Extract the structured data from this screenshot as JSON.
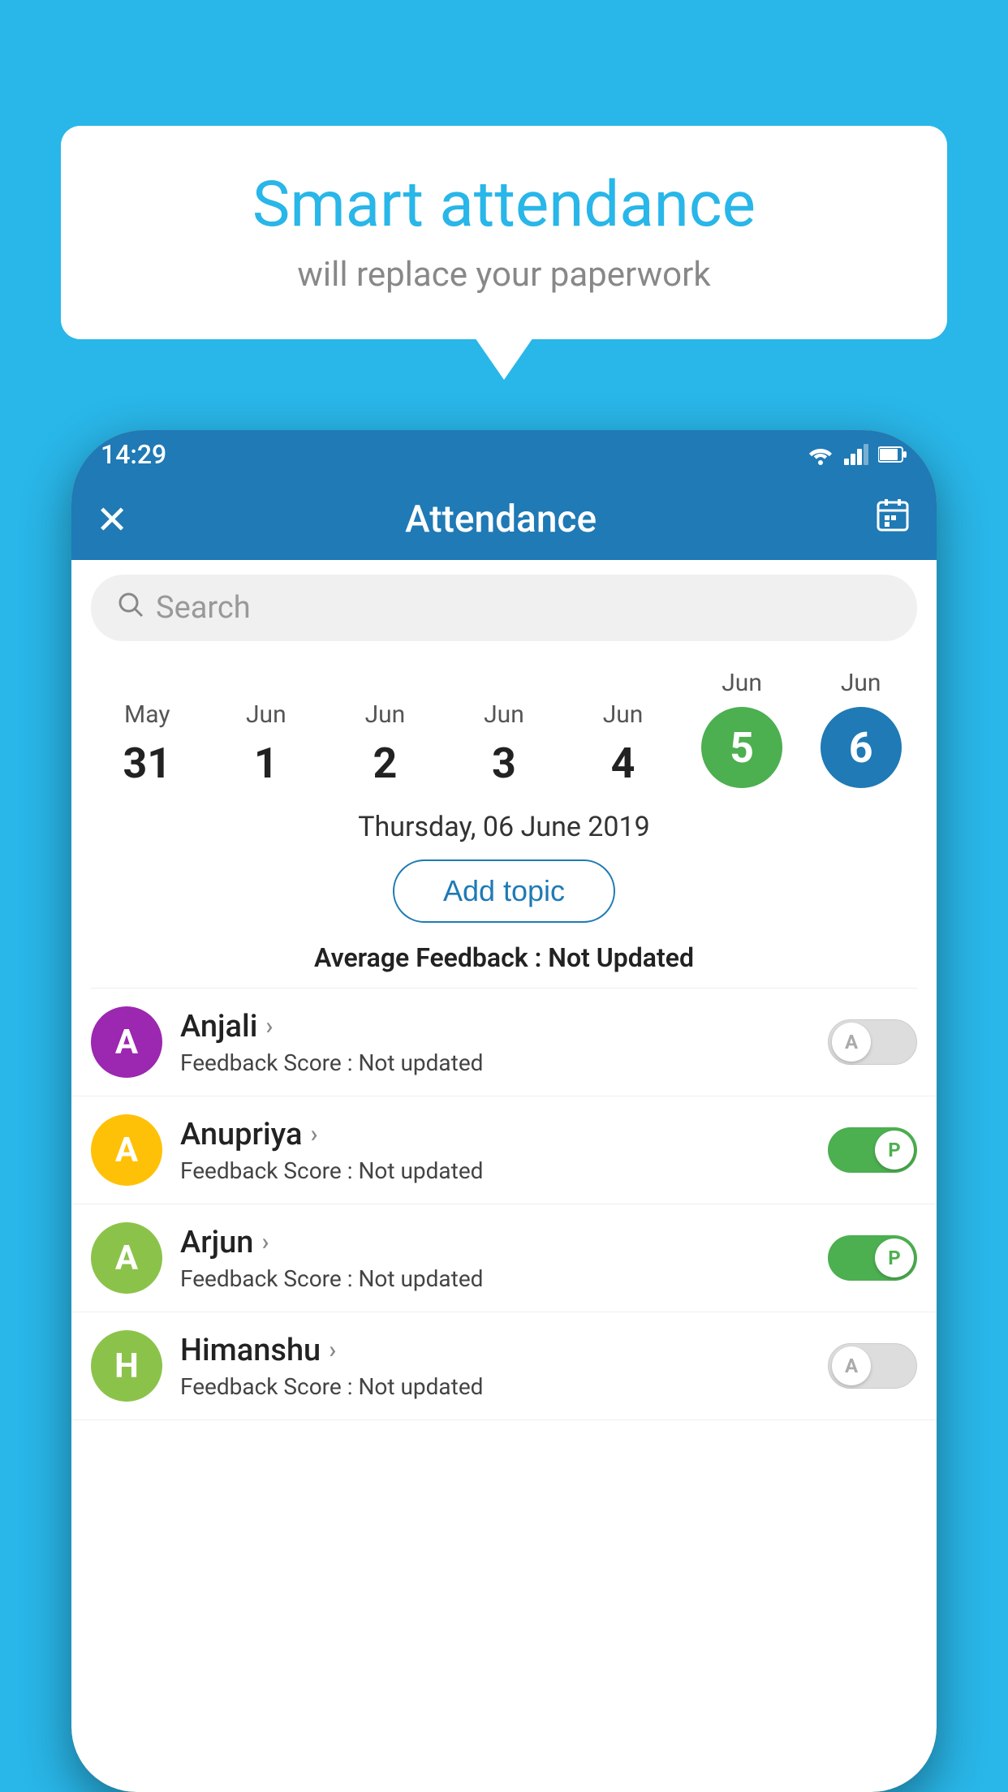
{
  "background_color": "#29B6E8",
  "speech_bubble": {
    "title": "Smart attendance",
    "subtitle": "will replace your paperwork"
  },
  "status_bar": {
    "time": "14:29",
    "icons": [
      "wifi",
      "signal",
      "battery"
    ]
  },
  "app_header": {
    "title": "Attendance",
    "close_label": "✕",
    "calendar_icon": "📅"
  },
  "search": {
    "placeholder": "Search"
  },
  "calendar": {
    "days": [
      {
        "month": "May",
        "date": "31",
        "circle": false
      },
      {
        "month": "Jun",
        "date": "1",
        "circle": false
      },
      {
        "month": "Jun",
        "date": "2",
        "circle": false
      },
      {
        "month": "Jun",
        "date": "3",
        "circle": false
      },
      {
        "month": "Jun",
        "date": "4",
        "circle": false
      },
      {
        "month": "Jun",
        "date": "5",
        "circle": "green"
      },
      {
        "month": "Jun",
        "date": "6",
        "circle": "blue"
      }
    ],
    "selected_date": "Thursday, 06 June 2019"
  },
  "add_topic_label": "Add topic",
  "avg_feedback_label": "Average Feedback :",
  "avg_feedback_value": "Not Updated",
  "students": [
    {
      "name": "Anjali",
      "avatar_letter": "A",
      "avatar_color": "#9C27B0",
      "feedback_label": "Feedback Score :",
      "feedback_value": "Not updated",
      "toggle": "off",
      "toggle_label": "A"
    },
    {
      "name": "Anupriya",
      "avatar_letter": "A",
      "avatar_color": "#FFC107",
      "feedback_label": "Feedback Score :",
      "feedback_value": "Not updated",
      "toggle": "on",
      "toggle_label": "P"
    },
    {
      "name": "Arjun",
      "avatar_letter": "A",
      "avatar_color": "#8BC34A",
      "feedback_label": "Feedback Score :",
      "feedback_value": "Not updated",
      "toggle": "on",
      "toggle_label": "P"
    },
    {
      "name": "Himanshu",
      "avatar_letter": "H",
      "avatar_color": "#8BC34A",
      "feedback_label": "Feedback Score :",
      "feedback_value": "Not updated",
      "toggle": "off",
      "toggle_label": "A"
    }
  ]
}
